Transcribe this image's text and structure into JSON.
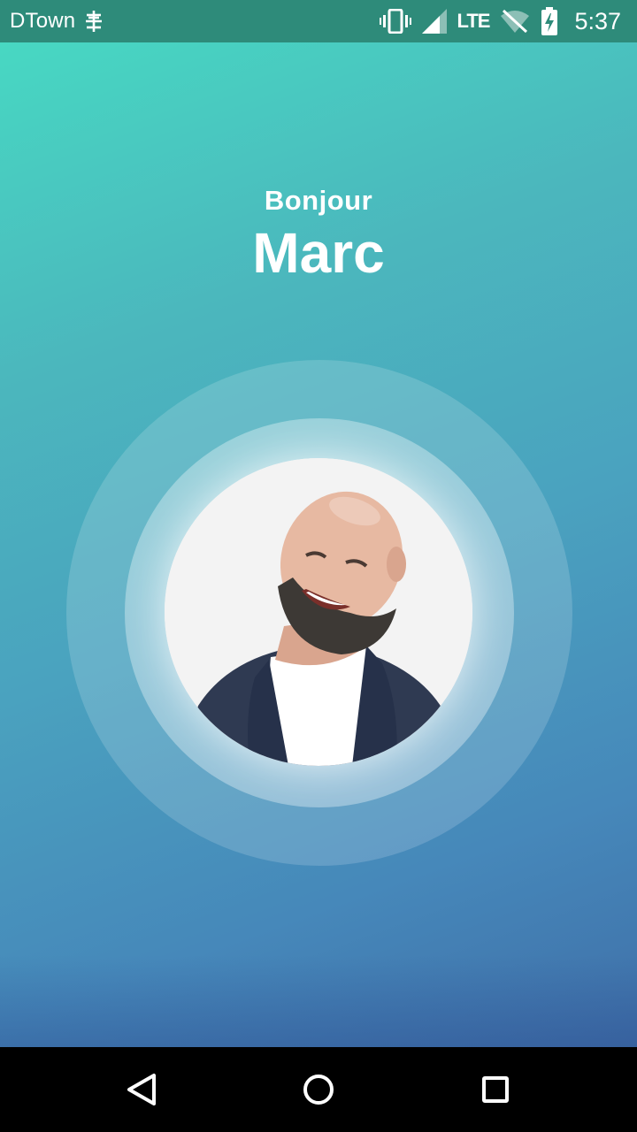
{
  "status_bar": {
    "carrier": "DTown",
    "network": "LTE",
    "time": "5:37",
    "icons": [
      "carrier-settings-icon",
      "vibrate-icon",
      "cell-signal-icon",
      "wifi-off-icon",
      "battery-charging-icon"
    ]
  },
  "greeting": {
    "salutation": "Bonjour",
    "name": "Marc"
  },
  "profile": {
    "avatar_icon": "profile-photo"
  },
  "navigation": {
    "icons": [
      "back-icon",
      "home-icon",
      "recents-icon"
    ]
  },
  "colors": {
    "gradient_top": "#47dcc3",
    "gradient_bottom": "#3f6fa8",
    "status_bar": "#2e8b7a",
    "text": "#ffffff"
  }
}
